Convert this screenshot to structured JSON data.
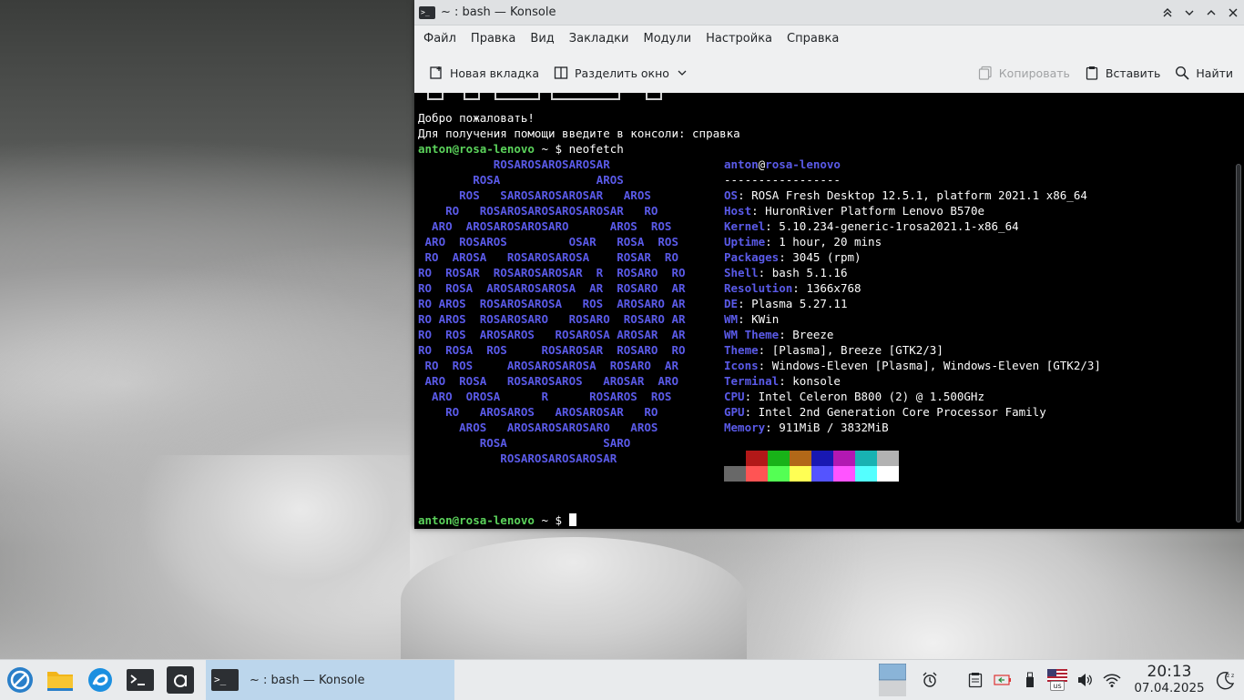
{
  "window": {
    "title": "~ : bash — Konsole",
    "controls": [
      "⌃",
      "⌄",
      "⌃",
      "✕"
    ]
  },
  "menubar": [
    "Файл",
    "Правка",
    "Вид",
    "Закладки",
    "Модули",
    "Настройка",
    "Справка"
  ],
  "toolbar": {
    "new_tab": "Новая вкладка",
    "split": "Разделить окно",
    "copy": "Копировать",
    "paste": "Вставить",
    "find": "Найти"
  },
  "terminal": {
    "welcome": "Добро пожаловать!",
    "help": "Для получения помощи введите в консоли: справка",
    "prompt_user": "anton@rosa-lenovo",
    "prompt_path": " ~ $ ",
    "command": "neofetch",
    "logo": [
      "           ROSAROSAROSAROSAR",
      "        ROSA              AROS",
      "      ROS   SAROSAROSAROSAR   AROS",
      "    RO   ROSAROSAROSAROSAROSAR   RO",
      "  ARO  AROSAROSAROSARO      AROS  ROS",
      " ARO  ROSAROS         OSAR   ROSA  ROS",
      " RO  AROSA   ROSAROSAROSA    ROSAR  RO",
      "RO  ROSAR  ROSAROSAROSAR  R  ROSARO  RO",
      "RO  ROSA  AROSAROSAROSA  AR  ROSARO  AR",
      "RO AROS  ROSAROSAROSA   ROS  AROSARO AR",
      "RO AROS  ROSAROSARO   ROSARO  ROSARO AR",
      "RO  ROS  AROSAROS   ROSAROSA AROSAR  AR",
      "RO  ROSA  ROS     ROSAROSAR  ROSARO  RO",
      " RO  ROS     AROSAROSAROSA  ROSARO  AR",
      " ARO  ROSA   ROSAROSAROS   AROSAR  ARO",
      "  ARO  OROSA      R      ROSAROS  ROS",
      "    RO   AROSAROS   AROSAROSAR   RO",
      "      AROS   AROSAROSAROSARO   AROS",
      "         ROSA              SARO",
      "            ROSAROSAROSAROSAR"
    ],
    "info_header_user": "anton",
    "info_header_host": "rosa-lenovo",
    "info_sep": "-----------------",
    "info": [
      {
        "k": "OS",
        "v": "ROSA Fresh Desktop 12.5.1, platform 2021.1 x86_64"
      },
      {
        "k": "Host",
        "v": "HuronRiver Platform Lenovo B570e"
      },
      {
        "k": "Kernel",
        "v": "5.10.234-generic-1rosa2021.1-x86_64"
      },
      {
        "k": "Uptime",
        "v": "1 hour, 20 mins"
      },
      {
        "k": "Packages",
        "v": "3045 (rpm)"
      },
      {
        "k": "Shell",
        "v": "bash 5.1.16"
      },
      {
        "k": "Resolution",
        "v": "1366x768"
      },
      {
        "k": "DE",
        "v": "Plasma 5.27.11"
      },
      {
        "k": "WM",
        "v": "KWin"
      },
      {
        "k": "WM Theme",
        "v": "Breeze"
      },
      {
        "k": "Theme",
        "v": "[Plasma], Breeze [GTK2/3]"
      },
      {
        "k": "Icons",
        "v": "Windows-Eleven [Plasma], Windows-Eleven [GTK2/3]"
      },
      {
        "k": "Terminal",
        "v": "konsole"
      },
      {
        "k": "CPU",
        "v": "Intel Celeron B800 (2) @ 1.500GHz"
      },
      {
        "k": "GPU",
        "v": "Intel 2nd Generation Core Processor Family"
      },
      {
        "k": "Memory",
        "v": "911MiB / 3832MiB"
      }
    ],
    "palette_dark": [
      "#000000",
      "#b21818",
      "#18b218",
      "#b26818",
      "#1818b2",
      "#b218b2",
      "#18b2b2",
      "#b2b2b2"
    ],
    "palette_bright": [
      "#686868",
      "#ff5454",
      "#54ff54",
      "#ffff54",
      "#5454ff",
      "#ff54ff",
      "#54ffff",
      "#ffffff"
    ],
    "colors": {
      "logo": "#5a5ae8",
      "prompt": "#5bd35b",
      "text": "#fcfcfc"
    }
  },
  "taskbar": {
    "task_label": "~ : bash — Konsole",
    "kbd_layout": "us",
    "time": "20:13",
    "date": "07.04.2025"
  }
}
